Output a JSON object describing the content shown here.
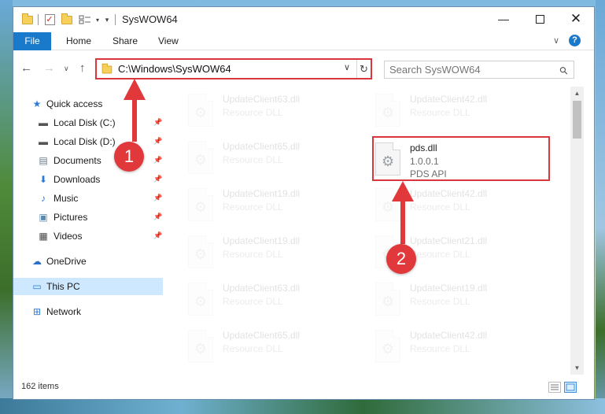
{
  "window": {
    "title": "SysWOW64"
  },
  "ribbon": {
    "tabs": [
      {
        "label": "File"
      },
      {
        "label": "Home"
      },
      {
        "label": "Share"
      },
      {
        "label": "View"
      }
    ],
    "help_label": "?"
  },
  "address": {
    "path": "C:\\Windows\\SysWOW64"
  },
  "search": {
    "placeholder": "Search SysWOW64"
  },
  "sidebar": {
    "items": [
      {
        "label": "Quick access",
        "icon": "star-icon",
        "pinned": false
      },
      {
        "label": "Local Disk (C:)",
        "icon": "drive-icon",
        "pinned": true
      },
      {
        "label": "Local Disk (D:)",
        "icon": "drive-icon",
        "pinned": true
      },
      {
        "label": "Documents",
        "icon": "documents-icon",
        "pinned": true
      },
      {
        "label": "Downloads",
        "icon": "download-icon",
        "pinned": true
      },
      {
        "label": "Music",
        "icon": "music-icon",
        "pinned": true
      },
      {
        "label": "Pictures",
        "icon": "pictures-icon",
        "pinned": true
      },
      {
        "label": "Videos",
        "icon": "videos-icon",
        "pinned": true
      },
      {
        "label": "OneDrive",
        "icon": "cloud-icon",
        "pinned": false
      },
      {
        "label": "This PC",
        "icon": "computer-icon",
        "pinned": false,
        "selected": true
      },
      {
        "label": "Network",
        "icon": "network-icon",
        "pinned": false
      }
    ]
  },
  "files": [
    {
      "name": "UpdateClient63.dll",
      "line2": "Resource DLL",
      "faded": true
    },
    {
      "name": "UpdateClient42.dll",
      "line2": "Resource DLL",
      "faded": true
    },
    {
      "name": "UpdateClient65.dll",
      "line2": "Resource DLL",
      "faded": true
    },
    {
      "name": "pds.dll",
      "line2": "1.0.0.1",
      "line3": "PDS API",
      "faded": false
    },
    {
      "name": "UpdateClient19.dll",
      "line2": "Resource DLL",
      "faded": true
    },
    {
      "name": "UpdateClient42.dll",
      "line2": "Resource DLL",
      "faded": true
    },
    {
      "name": "UpdateClient19.dll",
      "line2": "Resource DLL",
      "faded": true
    },
    {
      "name": "UpdateClient21.dll",
      "line2": "Resource DLL",
      "faded": true
    },
    {
      "name": "UpdateClient63.dll",
      "line2": "Resource DLL",
      "faded": true
    },
    {
      "name": "UpdateClient19.dll",
      "line2": "Resource DLL",
      "faded": true
    },
    {
      "name": "UpdateClient65.dll",
      "line2": "Resource DLL",
      "faded": true
    },
    {
      "name": "UpdateClient42.dll",
      "line2": "Resource DLL",
      "faded": true
    }
  ],
  "status": {
    "item_count": "162 items"
  },
  "annotations": {
    "step1": "1",
    "step2": "2"
  },
  "colors": {
    "accent": "#1979ca",
    "highlight_red": "#d9363e",
    "selected_bg": "#cde8ff"
  }
}
